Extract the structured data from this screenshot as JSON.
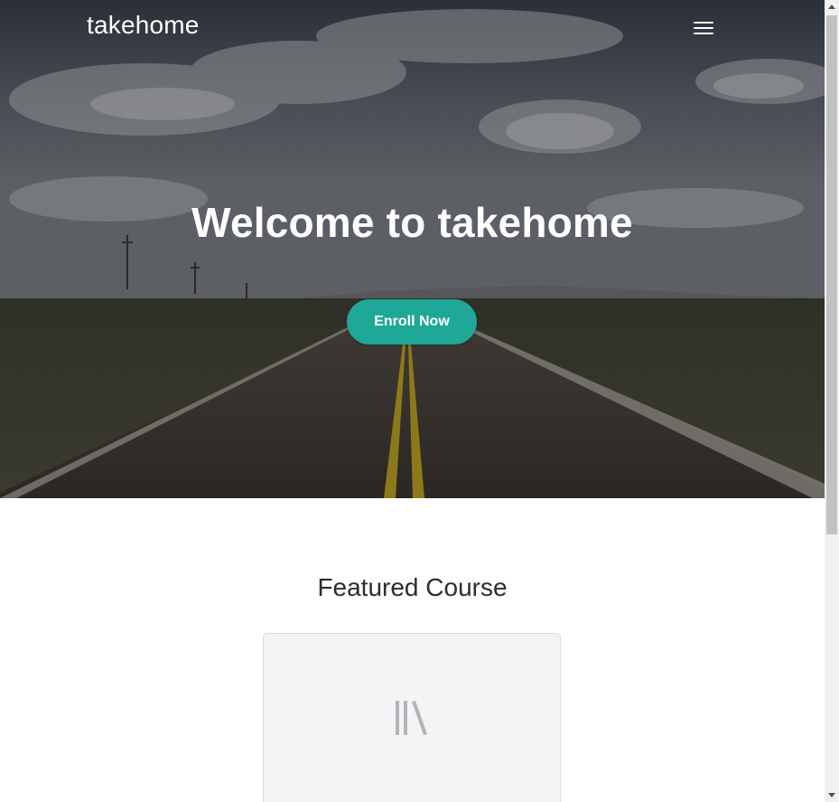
{
  "nav": {
    "brand": "takehome",
    "menu_icon": "hamburger-menu-icon"
  },
  "hero": {
    "title": "Welcome to takehome",
    "cta_label": "Enroll Now",
    "background": "road-landscape-photo"
  },
  "featured": {
    "heading": "Featured Course",
    "course_icon": "library-books-icon"
  },
  "colors": {
    "accent": "#1fa797",
    "heading_text": "#2a2d33",
    "card_bg": "#f3f4f6",
    "card_border": "#cfe2e0"
  }
}
